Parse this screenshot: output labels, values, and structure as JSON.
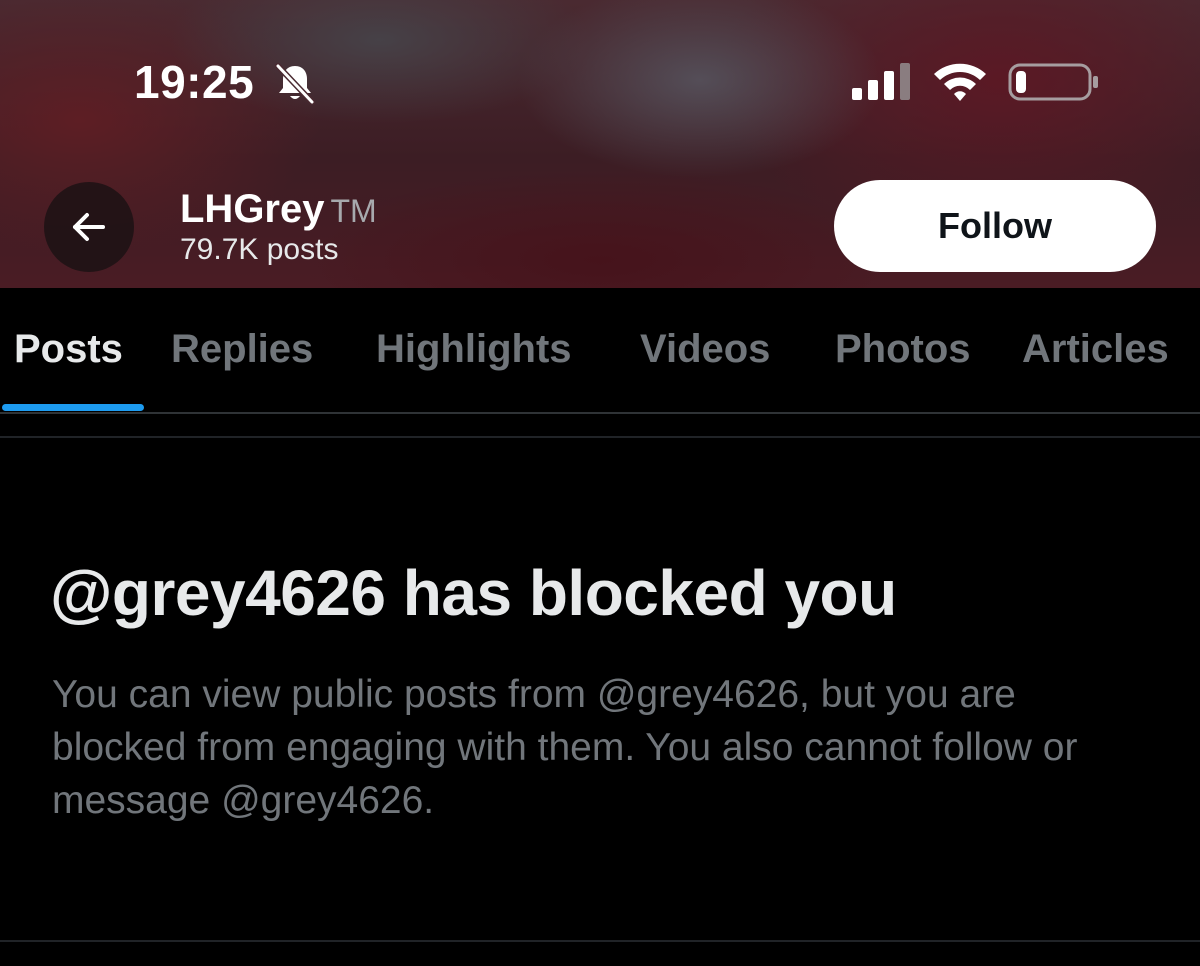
{
  "status_bar": {
    "time": "19:25",
    "icons": [
      "bell-slash-icon",
      "signal-icon",
      "wifi-icon",
      "battery-icon"
    ],
    "battery_level": 0.12
  },
  "header": {
    "name": "LHGrey",
    "name_suffix": "TM",
    "post_count": "79.7K posts",
    "follow_label": "Follow",
    "back_icon": "arrow-left-icon"
  },
  "tabs": [
    {
      "label": "Posts",
      "active": true
    },
    {
      "label": "Replies",
      "active": false
    },
    {
      "label": "Highlights",
      "active": false
    },
    {
      "label": "Videos",
      "active": false
    },
    {
      "label": "Photos",
      "active": false
    },
    {
      "label": "Articles",
      "active": false
    }
  ],
  "blocked": {
    "title": "@grey4626 has blocked you",
    "description": "You can view public posts from @grey4626, but you are blocked from engaging with them. You also cannot follow or message @grey4626."
  },
  "colors": {
    "accent": "#1d9bf0",
    "background": "#000000",
    "text_primary": "#e7e9ea",
    "text_secondary": "#71767b"
  }
}
